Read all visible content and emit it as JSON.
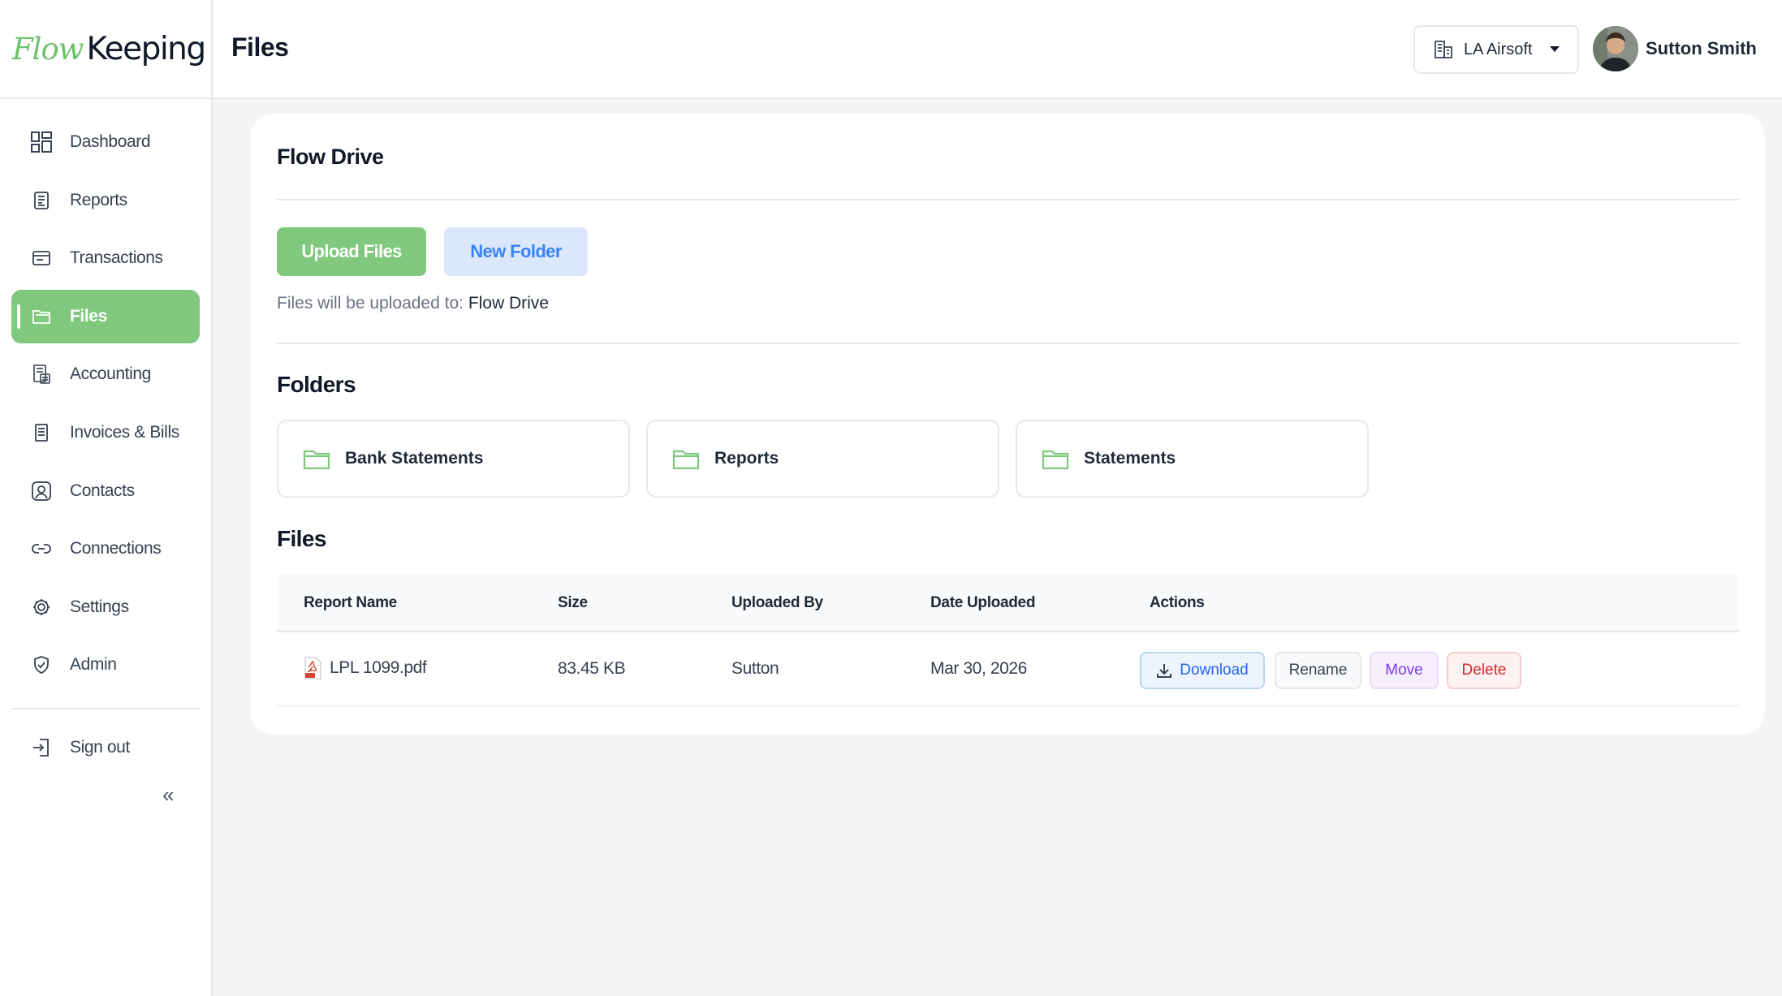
{
  "brand": {
    "logo_part1": "Flow",
    "logo_part2": "Keeping",
    "accent": "#7fc87d"
  },
  "sidebar": {
    "items": [
      {
        "label": "Dashboard",
        "icon": "dashboard-icon"
      },
      {
        "label": "Reports",
        "icon": "reports-icon"
      },
      {
        "label": "Transactions",
        "icon": "transactions-icon"
      },
      {
        "label": "Files",
        "icon": "folder-open-icon",
        "active": true
      },
      {
        "label": "Accounting",
        "icon": "accounting-icon"
      },
      {
        "label": "Invoices & Bills",
        "icon": "invoice-icon"
      },
      {
        "label": "Contacts",
        "icon": "contact-icon"
      },
      {
        "label": "Connections",
        "icon": "link-icon"
      },
      {
        "label": "Settings",
        "icon": "gear-icon"
      },
      {
        "label": "Admin",
        "icon": "shield-icon"
      }
    ],
    "signout": {
      "label": "Sign out",
      "icon": "sign-in-icon"
    },
    "collapse_glyph": "«"
  },
  "header": {
    "title": "Files",
    "org": {
      "selected": "LA Airsoft",
      "icon": "building-icon"
    },
    "user": {
      "name": "Sutton Smith"
    }
  },
  "drive": {
    "title": "Flow Drive",
    "upload_button": "Upload Files",
    "new_folder_button": "New Folder",
    "upload_note_prefix": "Files will be uploaded to:",
    "upload_destination": "Flow Drive"
  },
  "folders": {
    "heading": "Folders",
    "items": [
      {
        "name": "Bank Statements"
      },
      {
        "name": "Reports"
      },
      {
        "name": "Statements"
      }
    ]
  },
  "files": {
    "heading": "Files",
    "columns": [
      "Report Name",
      "Size",
      "Uploaded By",
      "Date Uploaded",
      "Actions"
    ],
    "rows": [
      {
        "name": "LPL 1099.pdf",
        "size": "83.45 KB",
        "uploaded_by": "Sutton",
        "date": "Mar 30, 2026"
      }
    ],
    "actions": {
      "download": "Download",
      "rename": "Rename",
      "move": "Move",
      "delete": "Delete"
    }
  }
}
